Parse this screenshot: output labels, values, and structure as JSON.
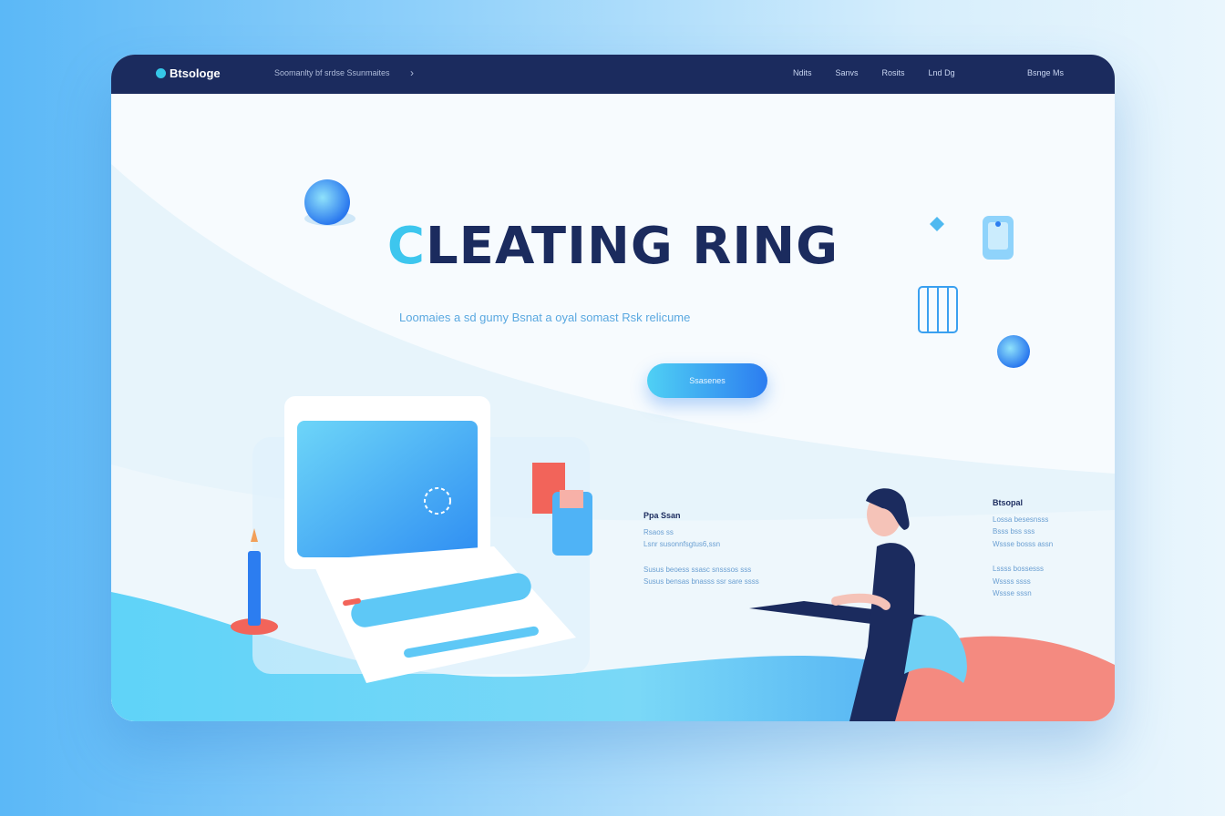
{
  "nav": {
    "logo": "Btsologe",
    "breadcrumb": "Soomanlty bf srdse Ssunmaites",
    "links": [
      "Ndits",
      "Sanvs",
      "Rosits",
      "Lnd Dg"
    ],
    "account": "Bsnge Ms"
  },
  "hero": {
    "title_first": "C",
    "title_rest": "LEATING RING",
    "subtitle": "Loomaies a sd gumy Bsnat a oyal somast Rsk relicume",
    "cta_label": "Ssasenes"
  },
  "info_left": {
    "heading": "Ppa Ssan",
    "lines": [
      "Rsaos ss",
      "Lsnr susonnfsgtus6,ssn"
    ],
    "lines2": [
      "Susus beoess ssasc snsssos sss",
      "Susus bensas bnasss ssr sare ssss"
    ]
  },
  "info_right": {
    "heading": "Btsopal",
    "lines": [
      "Lossa besesnsss",
      "Bsss bss sss",
      "Wssse bosss assn"
    ],
    "lines2": [
      "Lssss bossesss",
      "Wssss ssss",
      "Wssse sssn"
    ]
  },
  "colors": {
    "nav_bg": "#1b2b5e",
    "accent_cyan": "#3dc6ee",
    "accent_blue": "#2c7df0",
    "coral": "#f48a80",
    "title_navy": "#1b2b5e"
  },
  "icons": [
    "logo-dot-icon",
    "chevron-right-icon"
  ]
}
